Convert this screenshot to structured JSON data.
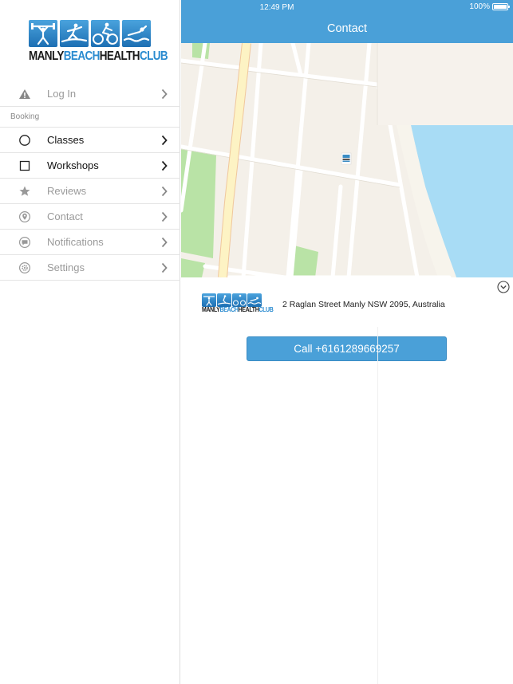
{
  "status_bar": {
    "time": "12:49 PM",
    "battery": "100%"
  },
  "header": {
    "title": "Contact"
  },
  "logo": {
    "part1": "MANLY",
    "part2": "BEACH",
    "part3": "HEALTH",
    "part4": "CLUB"
  },
  "sidebar": {
    "login": {
      "label": "Log In",
      "icon": "warning-icon"
    },
    "section": "Booking",
    "items": [
      {
        "label": "Classes",
        "icon": "circle-icon",
        "enabled": true
      },
      {
        "label": "Workshops",
        "icon": "square-icon",
        "enabled": true
      },
      {
        "label": "Reviews",
        "icon": "star-icon",
        "enabled": false
      },
      {
        "label": "Contact",
        "icon": "location-pin-icon",
        "enabled": false
      },
      {
        "label": "Notifications",
        "icon": "chat-bubble-icon",
        "enabled": false
      },
      {
        "label": "Settings",
        "icon": "gear-icon",
        "enabled": false
      }
    ]
  },
  "contact": {
    "address": "2 Raglan Street Manly NSW 2095, Australia",
    "call_label": "Call +6161289669257"
  },
  "colors": {
    "accent": "#4aa0d8",
    "water": "#a8dcf5",
    "park": "#b9e3a6",
    "road": "#fdf3c4"
  }
}
